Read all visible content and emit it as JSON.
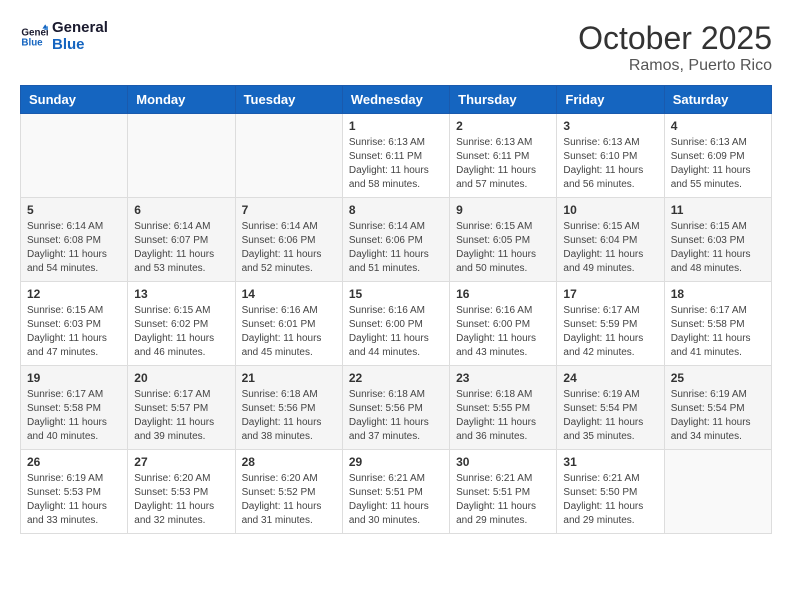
{
  "logo": {
    "line1": "General",
    "line2": "Blue"
  },
  "title": "October 2025",
  "subtitle": "Ramos, Puerto Rico",
  "days_of_week": [
    "Sunday",
    "Monday",
    "Tuesday",
    "Wednesday",
    "Thursday",
    "Friday",
    "Saturday"
  ],
  "weeks": [
    [
      {
        "day": "",
        "info": ""
      },
      {
        "day": "",
        "info": ""
      },
      {
        "day": "",
        "info": ""
      },
      {
        "day": "1",
        "info": "Sunrise: 6:13 AM\nSunset: 6:11 PM\nDaylight: 11 hours\nand 58 minutes."
      },
      {
        "day": "2",
        "info": "Sunrise: 6:13 AM\nSunset: 6:11 PM\nDaylight: 11 hours\nand 57 minutes."
      },
      {
        "day": "3",
        "info": "Sunrise: 6:13 AM\nSunset: 6:10 PM\nDaylight: 11 hours\nand 56 minutes."
      },
      {
        "day": "4",
        "info": "Sunrise: 6:13 AM\nSunset: 6:09 PM\nDaylight: 11 hours\nand 55 minutes."
      }
    ],
    [
      {
        "day": "5",
        "info": "Sunrise: 6:14 AM\nSunset: 6:08 PM\nDaylight: 11 hours\nand 54 minutes."
      },
      {
        "day": "6",
        "info": "Sunrise: 6:14 AM\nSunset: 6:07 PM\nDaylight: 11 hours\nand 53 minutes."
      },
      {
        "day": "7",
        "info": "Sunrise: 6:14 AM\nSunset: 6:06 PM\nDaylight: 11 hours\nand 52 minutes."
      },
      {
        "day": "8",
        "info": "Sunrise: 6:14 AM\nSunset: 6:06 PM\nDaylight: 11 hours\nand 51 minutes."
      },
      {
        "day": "9",
        "info": "Sunrise: 6:15 AM\nSunset: 6:05 PM\nDaylight: 11 hours\nand 50 minutes."
      },
      {
        "day": "10",
        "info": "Sunrise: 6:15 AM\nSunset: 6:04 PM\nDaylight: 11 hours\nand 49 minutes."
      },
      {
        "day": "11",
        "info": "Sunrise: 6:15 AM\nSunset: 6:03 PM\nDaylight: 11 hours\nand 48 minutes."
      }
    ],
    [
      {
        "day": "12",
        "info": "Sunrise: 6:15 AM\nSunset: 6:03 PM\nDaylight: 11 hours\nand 47 minutes."
      },
      {
        "day": "13",
        "info": "Sunrise: 6:15 AM\nSunset: 6:02 PM\nDaylight: 11 hours\nand 46 minutes."
      },
      {
        "day": "14",
        "info": "Sunrise: 6:16 AM\nSunset: 6:01 PM\nDaylight: 11 hours\nand 45 minutes."
      },
      {
        "day": "15",
        "info": "Sunrise: 6:16 AM\nSunset: 6:00 PM\nDaylight: 11 hours\nand 44 minutes."
      },
      {
        "day": "16",
        "info": "Sunrise: 6:16 AM\nSunset: 6:00 PM\nDaylight: 11 hours\nand 43 minutes."
      },
      {
        "day": "17",
        "info": "Sunrise: 6:17 AM\nSunset: 5:59 PM\nDaylight: 11 hours\nand 42 minutes."
      },
      {
        "day": "18",
        "info": "Sunrise: 6:17 AM\nSunset: 5:58 PM\nDaylight: 11 hours\nand 41 minutes."
      }
    ],
    [
      {
        "day": "19",
        "info": "Sunrise: 6:17 AM\nSunset: 5:58 PM\nDaylight: 11 hours\nand 40 minutes."
      },
      {
        "day": "20",
        "info": "Sunrise: 6:17 AM\nSunset: 5:57 PM\nDaylight: 11 hours\nand 39 minutes."
      },
      {
        "day": "21",
        "info": "Sunrise: 6:18 AM\nSunset: 5:56 PM\nDaylight: 11 hours\nand 38 minutes."
      },
      {
        "day": "22",
        "info": "Sunrise: 6:18 AM\nSunset: 5:56 PM\nDaylight: 11 hours\nand 37 minutes."
      },
      {
        "day": "23",
        "info": "Sunrise: 6:18 AM\nSunset: 5:55 PM\nDaylight: 11 hours\nand 36 minutes."
      },
      {
        "day": "24",
        "info": "Sunrise: 6:19 AM\nSunset: 5:54 PM\nDaylight: 11 hours\nand 35 minutes."
      },
      {
        "day": "25",
        "info": "Sunrise: 6:19 AM\nSunset: 5:54 PM\nDaylight: 11 hours\nand 34 minutes."
      }
    ],
    [
      {
        "day": "26",
        "info": "Sunrise: 6:19 AM\nSunset: 5:53 PM\nDaylight: 11 hours\nand 33 minutes."
      },
      {
        "day": "27",
        "info": "Sunrise: 6:20 AM\nSunset: 5:53 PM\nDaylight: 11 hours\nand 32 minutes."
      },
      {
        "day": "28",
        "info": "Sunrise: 6:20 AM\nSunset: 5:52 PM\nDaylight: 11 hours\nand 31 minutes."
      },
      {
        "day": "29",
        "info": "Sunrise: 6:21 AM\nSunset: 5:51 PM\nDaylight: 11 hours\nand 30 minutes."
      },
      {
        "day": "30",
        "info": "Sunrise: 6:21 AM\nSunset: 5:51 PM\nDaylight: 11 hours\nand 29 minutes."
      },
      {
        "day": "31",
        "info": "Sunrise: 6:21 AM\nSunset: 5:50 PM\nDaylight: 11 hours\nand 29 minutes."
      },
      {
        "day": "",
        "info": ""
      }
    ]
  ]
}
